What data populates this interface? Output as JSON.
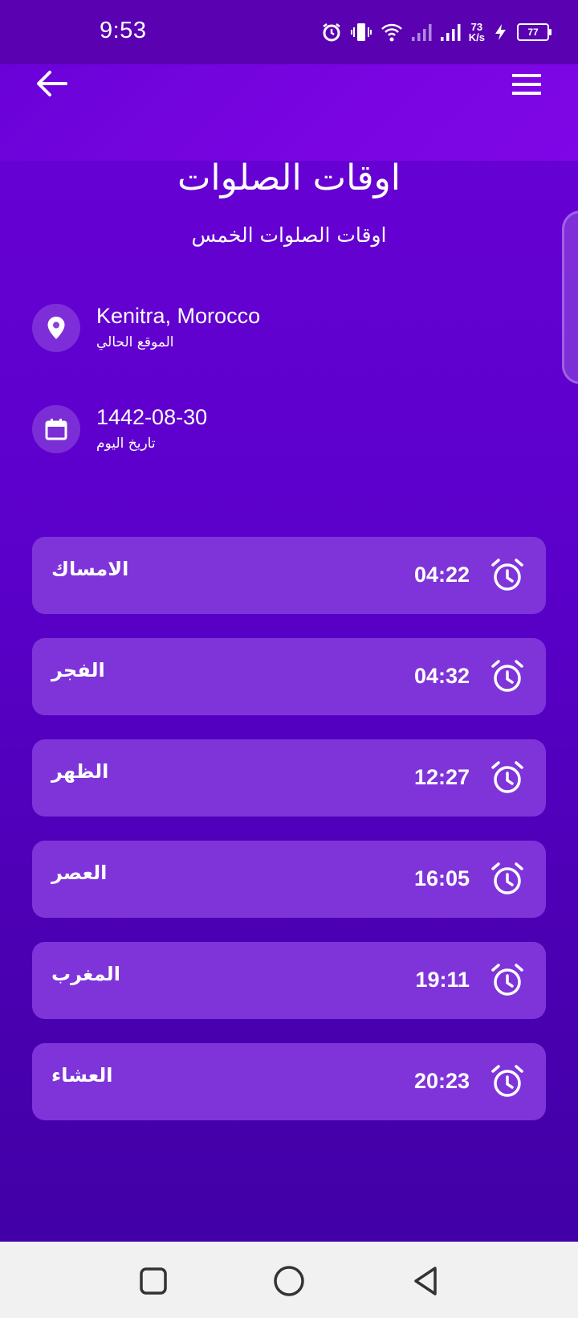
{
  "status_bar": {
    "time": "9:53",
    "net_speed_value": "73",
    "net_speed_unit": "K/s",
    "battery": "77",
    "icons": [
      "alarm-icon",
      "vibrate-icon",
      "wifi-icon",
      "signal-weak-icon",
      "signal-icon",
      "charging-icon",
      "battery-icon"
    ]
  },
  "header": {
    "title": "اوقات الصلوات",
    "subtitle": "اوقات الصلوات الخمس"
  },
  "location": {
    "city": "Kenitra, Morocco",
    "label": "الموقع الحالي"
  },
  "date": {
    "value": "1442-08-30",
    "label": "تاريخ اليوم"
  },
  "prayers": [
    {
      "name": "الامساك",
      "time": "04:22"
    },
    {
      "name": "الفجر",
      "time": "04:32"
    },
    {
      "name": "الظهر",
      "time": "12:27"
    },
    {
      "name": "العصر",
      "time": "16:05"
    },
    {
      "name": "المغرب",
      "time": "19:11"
    },
    {
      "name": "العشاء",
      "time": "20:23"
    }
  ],
  "colors": {
    "background_top": "#6a02d6",
    "background_bottom": "#3f00a4",
    "card": "#7f34da",
    "nav_bar": "#f1f1f1"
  }
}
